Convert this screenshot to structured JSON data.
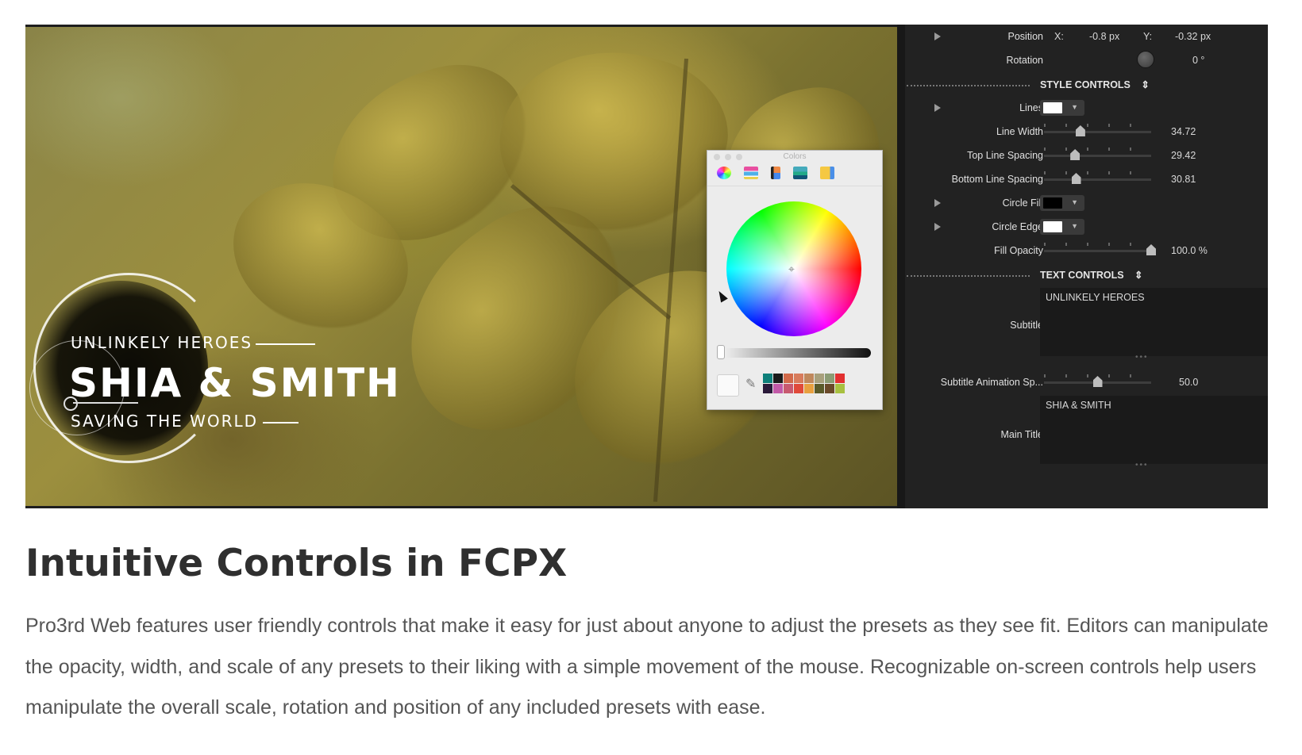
{
  "viewer": {
    "subtitle_text": "UNLINKELY HEROES",
    "main_title_text": "SHIA & SMITH",
    "tagline_text": "SAVING THE WORLD"
  },
  "colors_window": {
    "title": "Colors",
    "tabs": [
      "color-wheel-icon",
      "color-sliders-icon",
      "color-palettes-icon",
      "image-palettes-icon",
      "pencils-icon"
    ],
    "palette": [
      "#0e7f7a",
      "#1a1a1a",
      "#d26a4a",
      "#d87c5c",
      "#c0885c",
      "#a8a07c",
      "#8c9c74",
      "#e23030",
      "#2a1a3a",
      "#c25aa8",
      "#c85a70",
      "#e04a3a",
      "#e8a040",
      "#5a5a2a",
      "#6a4a2a",
      "#a8c040"
    ]
  },
  "inspector": {
    "position": {
      "label": "Position",
      "x_label": "X:",
      "x_value": "-0.8 px",
      "y_label": "Y:",
      "y_value": "-0.32 px"
    },
    "rotation": {
      "label": "Rotation",
      "value": "0 °"
    },
    "style_controls": {
      "label": "STYLE CONTROLS",
      "chevron": "⇕"
    },
    "lines": {
      "label": "Lines",
      "color": "#ffffff"
    },
    "line_width": {
      "label": "Line Width",
      "value": "34.72",
      "fraction": 0.34
    },
    "top_line_spacing": {
      "label": "Top Line Spacing",
      "value": "29.42",
      "fraction": 0.29
    },
    "bottom_line_spacing": {
      "label": "Bottom Line Spacing",
      "value": "30.81",
      "fraction": 0.3
    },
    "circle_fill": {
      "label": "Circle Fill",
      "color": "#000000"
    },
    "circle_edge": {
      "label": "Circle Edge",
      "color": "#ffffff"
    },
    "fill_opacity": {
      "label": "Fill Opacity",
      "value": "100.0 %",
      "fraction": 1.0
    },
    "text_controls": {
      "label": "TEXT CONTROLS",
      "chevron": "⇕"
    },
    "subtitle": {
      "label": "Subtitle",
      "value": "UNLINKELY HEROES"
    },
    "subtitle_anim": {
      "label": "Subtitle Animation Sp...",
      "value": "50.0",
      "fraction": 0.5
    },
    "main_title": {
      "label": "Main Title",
      "value": "SHIA & SMITH"
    }
  },
  "article": {
    "heading": "Intuitive Controls in FCPX",
    "body": "Pro3rd Web features user friendly controls that make it easy for just about anyone to adjust the presets as they see fit. Editors can manipulate the opacity, width, and scale of any presets to their liking with a simple movement of the mouse. Recognizable on-screen controls help users manipulate the overall scale, rotation and position of any included presets with ease."
  }
}
